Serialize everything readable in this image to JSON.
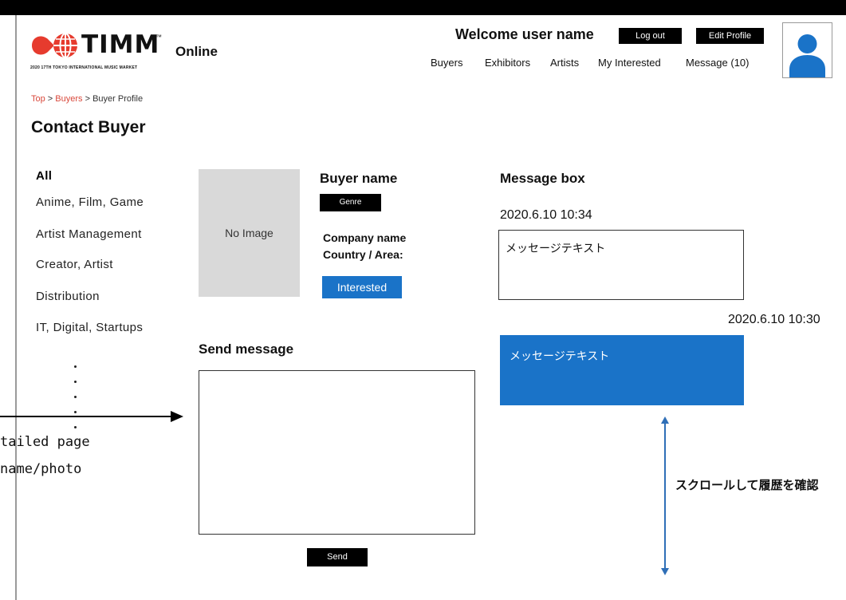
{
  "header": {
    "logo_text": "TIMM",
    "logo_tm": "™",
    "logo_subtitle": "2020 17TH TOKYO INTERNATIONAL MUSIC MARKET",
    "online_label": "Online",
    "welcome_text": "Welcome user name",
    "logout_label": "Log out",
    "edit_profile_label": "Edit Profile",
    "nav": {
      "buyers": "Buyers",
      "exhibitors": "Exhibitors",
      "artists": "Artists",
      "my_interested": "My Interested",
      "message": "Message (10)"
    },
    "colors": {
      "logo_red": "#e63b2e",
      "bar": "#000000"
    }
  },
  "breadcrumb": {
    "top": "Top",
    "sep": " > ",
    "buyers": "Buyers",
    "current": "Buyer Profile"
  },
  "page_title": "Contact Buyer",
  "sidebar": {
    "items": [
      {
        "label": "All"
      },
      {
        "label": "Anime, Film, Game"
      },
      {
        "label": "Artist Management"
      },
      {
        "label": "Creator, Artist"
      },
      {
        "label": "Distribution"
      },
      {
        "label": "IT, Digital, Startups"
      }
    ]
  },
  "annotation": {
    "line1": "tailed page",
    "line2": "name/photo"
  },
  "buyer": {
    "no_image_label": "No Image",
    "name": "Buyer name",
    "genre_label": "Genre",
    "company": "Company name",
    "country": "Country / Area:",
    "interested_label": "Interested"
  },
  "send": {
    "title": "Send message",
    "value": "",
    "button_label": "Send"
  },
  "messages": {
    "title": "Message box",
    "items": [
      {
        "timestamp": "2020.6.10  10:34",
        "text": "メッセージテキスト",
        "direction": "received"
      },
      {
        "timestamp": "2020.6.10  10:30",
        "text": "メッセージテキスト",
        "direction": "sent"
      }
    ],
    "scroll_note": "スクロールして履歴を確認"
  },
  "colors": {
    "accent_blue": "#1a73c8",
    "breadcrumb_link": "#d9483b",
    "placeholder_gray": "#d9d9d9"
  }
}
